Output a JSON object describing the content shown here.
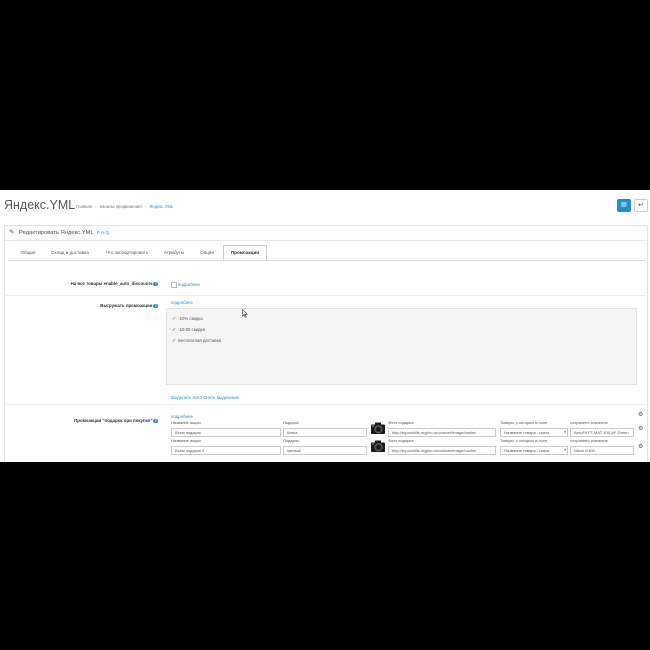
{
  "header": {
    "title": "Яндекс.YML",
    "breadcrumb": [
      "Главная",
      "Каналы продвижения",
      "Яндекс.YML"
    ],
    "save_icon": "save-icon",
    "back_icon": "back-icon"
  },
  "panel": {
    "title": "Редактировать Яндекс.YML",
    "faq": "F.A.Q."
  },
  "tabs": [
    "Общие",
    "Склад и доставка",
    "Что экспортировать",
    "Атрибуты",
    "Опции",
    "Промоакции"
  ],
  "active_tab": "Промоакции",
  "discounts": {
    "label": "На все товары enable_auto_discounts",
    "more": "подробнее"
  },
  "promocodes": {
    "label": "Выгружать промоакции",
    "more": "подробнее",
    "items": [
      "-10% скидка",
      "-10.00 скидка",
      "Бесплатная доставка"
    ],
    "select_all": "Выделить всё",
    "deselect": "Снять выделение"
  },
  "gift": {
    "label": "Промоакции \"подарок при покупке\"",
    "more": "подробнее",
    "col_name": "Название акции",
    "col_gift": "Подарок",
    "col_photo": "Фото подарка",
    "col_goods": "Товары, у которых в поле",
    "col_value": "сохранено значение",
    "rows": [
      {
        "name": "Всем подарок",
        "gift": "Катка",
        "photo": "http://topcrchills.myjino.ru/ocstore/image/cache/",
        "goods": "Название товара - галка",
        "value": "AeroFit FT-MAT-100-AF Green"
      },
      {
        "name": "Всем подарок 2",
        "gift": "samsa2",
        "photo": "http://topcrchills.myjino.ru/ocstore/image/cache/",
        "goods": "Название товара - галка",
        "value": "Nikon D300"
      }
    ]
  }
}
